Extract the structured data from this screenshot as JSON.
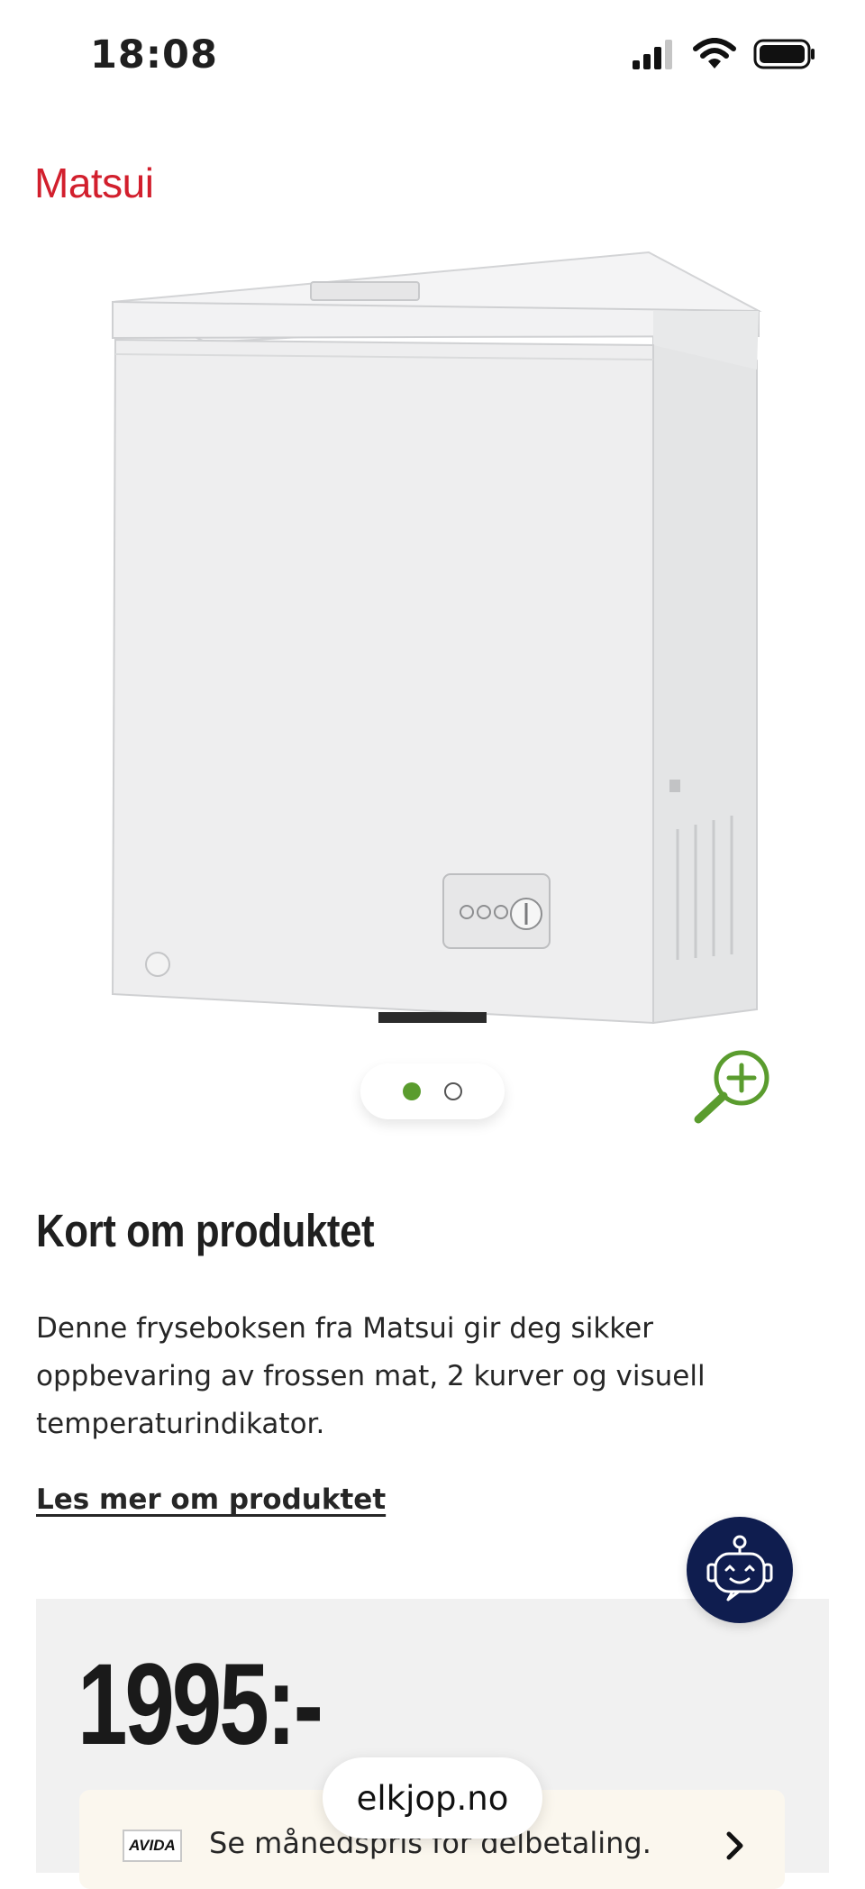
{
  "status_bar": {
    "time": "18:08",
    "icons": [
      "cellular-signal-icon",
      "wifi-icon",
      "battery-icon"
    ]
  },
  "brand": {
    "name": "Matsui",
    "color": "#d21f2d"
  },
  "product": {
    "image": "chest-freezer-image",
    "carousel": {
      "count": 2,
      "active_index": 0,
      "active_color": "#5a9c2e"
    },
    "zoom_icon": "zoom-in-icon"
  },
  "about": {
    "heading": "Kort om produktet",
    "description": "Denne fryseboksen fra Matsui gir deg sikker oppbevaring av frossen mat, 2 kurver og visuell temperaturindikator.",
    "read_more": "Les mer om produktet"
  },
  "assistant": {
    "icon": "chat-robot-icon",
    "color": "#0f1d4f"
  },
  "price": {
    "value": "1995:-",
    "financing": {
      "provider_logo": "AVIDA",
      "text": "Se månedspris for delbetaling.",
      "chevron": "chevron-right-icon"
    }
  },
  "browser": {
    "url": "elkjop.no"
  }
}
